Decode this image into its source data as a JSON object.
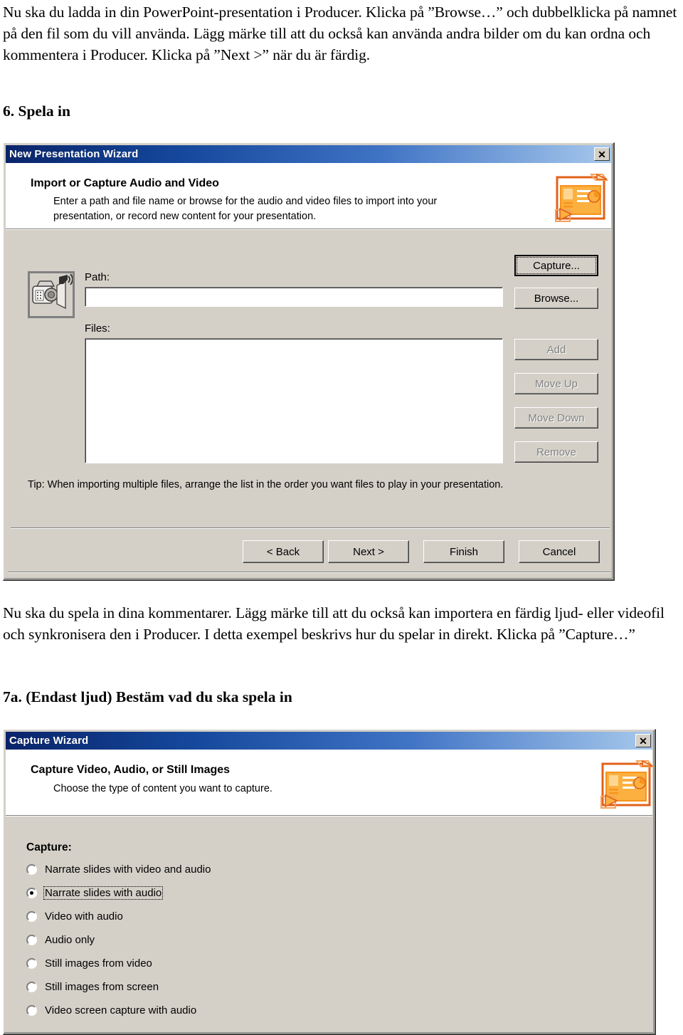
{
  "document": {
    "paragraph_top": "Nu ska du ladda in din PowerPoint-presentation i Producer. Klicka på ”Browse…” och dubbelklicka på namnet på den fil som du vill använda. Lägg märke till att du också kan använda andra bilder om du kan ordna och kommentera i Producer. Klicka på ”Next >” när du är färdig.",
    "heading_6": "6. Spela in",
    "paragraph_mid": "Nu ska du spela in dina kommentarer. Lägg märke till att du också kan importera en färdig ljud- eller videofil och synkronisera den i Producer. I detta exempel beskrivs hur du spelar in direkt. Klicka på ”Capture…”",
    "heading_7a": "7a. (Endast ljud) Bestäm vad du ska spela in"
  },
  "colors": {
    "dialog_face": "#d4d0c8",
    "titlebar_start": "#0a246a",
    "titlebar_end": "#a6c8ec",
    "header_white": "#ffffff",
    "icon_orange": "#f0931e",
    "disabled_text": "#808080"
  },
  "wizard1": {
    "title": "New Presentation Wizard",
    "close_label": "✕",
    "header_title": "Import or Capture Audio and Video",
    "header_sub_line1": "Enter a path and file name or browse for the audio and video files to import into your",
    "header_sub_line2": "presentation, or record new content for your presentation.",
    "path_label": "Path:",
    "path_value": "",
    "files_label": "Files:",
    "files_items": [],
    "side_buttons": [
      {
        "label": "Capture...",
        "state": "focused-default"
      },
      {
        "label": "Browse...",
        "state": "normal"
      },
      {
        "label": "Add",
        "state": "disabled"
      },
      {
        "label": "Move Up",
        "state": "disabled"
      },
      {
        "label": "Move Down",
        "state": "disabled"
      },
      {
        "label": "Remove",
        "state": "disabled"
      }
    ],
    "tip": "Tip: When importing multiple files, arrange the list in the order you want files to play in your presentation.",
    "nav_buttons": [
      {
        "label": "< Back",
        "state": "normal"
      },
      {
        "label": "Next >",
        "state": "normal"
      },
      {
        "label": "Finish",
        "state": "normal"
      },
      {
        "label": "Cancel",
        "state": "normal"
      }
    ]
  },
  "wizard2": {
    "title": "Capture Wizard",
    "close_label": "✕",
    "header_title": "Capture Video, Audio, or Still Images",
    "header_sub_line1": "Choose the type of content you want to capture.",
    "group_label": "Capture:",
    "options": [
      {
        "label": "Narrate slides with video and audio",
        "checked": false
      },
      {
        "label": "Narrate slides with audio",
        "checked": true
      },
      {
        "label": "Video with audio",
        "checked": false
      },
      {
        "label": "Audio only",
        "checked": false
      },
      {
        "label": "Still images from video",
        "checked": false
      },
      {
        "label": "Still images from screen",
        "checked": false
      },
      {
        "label": "Video screen capture with audio",
        "checked": false
      }
    ]
  }
}
